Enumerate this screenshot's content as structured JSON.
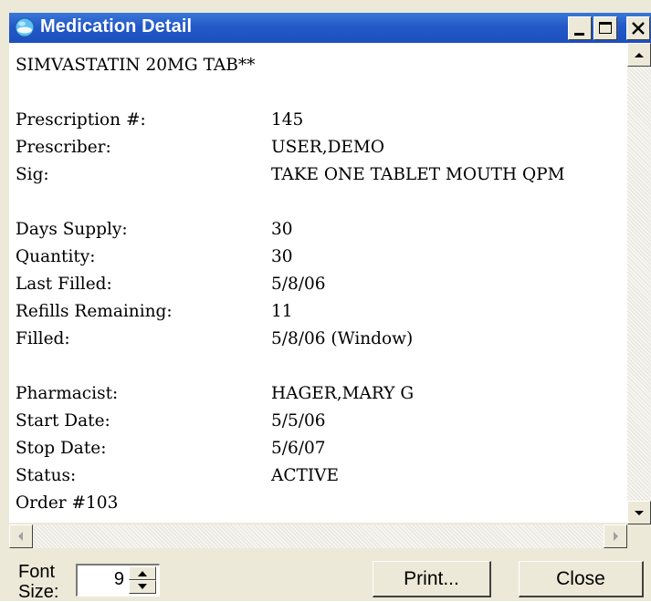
{
  "window": {
    "title": "Medication Detail"
  },
  "detail": {
    "heading": "SIMVASTATIN 20MG TAB**",
    "rows": [
      {
        "label": "Prescription #:",
        "value": "145"
      },
      {
        "label": "Prescriber:",
        "value": "USER,DEMO"
      },
      {
        "label": "Sig:",
        "value": "TAKE ONE TABLET MOUTH QPM"
      },
      {
        "label": "Days Supply:",
        "value": "30"
      },
      {
        "label": "Quantity:",
        "value": "30"
      },
      {
        "label": "Last Filled:",
        "value": "5/8/06"
      },
      {
        "label": "Refills Remaining:",
        "value": "11"
      },
      {
        "label": "Filled:",
        "value": "5/8/06 (Window)"
      },
      {
        "label": "Pharmacist:",
        "value": "HAGER,MARY G"
      },
      {
        "label": "Start Date:",
        "value": "5/5/06"
      },
      {
        "label": "Stop Date:",
        "value": "5/6/07"
      },
      {
        "label": "Status:",
        "value": "ACTIVE"
      }
    ],
    "footer": "Order #103"
  },
  "controls": {
    "font_size_label_1": "Font",
    "font_size_label_2": "Size:",
    "font_size_value": "9",
    "print_label": "Print...",
    "close_label": "Close"
  },
  "icons": {
    "app": "globe-icon",
    "minimize": "minimize-icon",
    "maximize": "maximize-icon",
    "close": "close-icon"
  },
  "colors": {
    "titlebar": "#2458c7",
    "face": "#ece9d8"
  }
}
